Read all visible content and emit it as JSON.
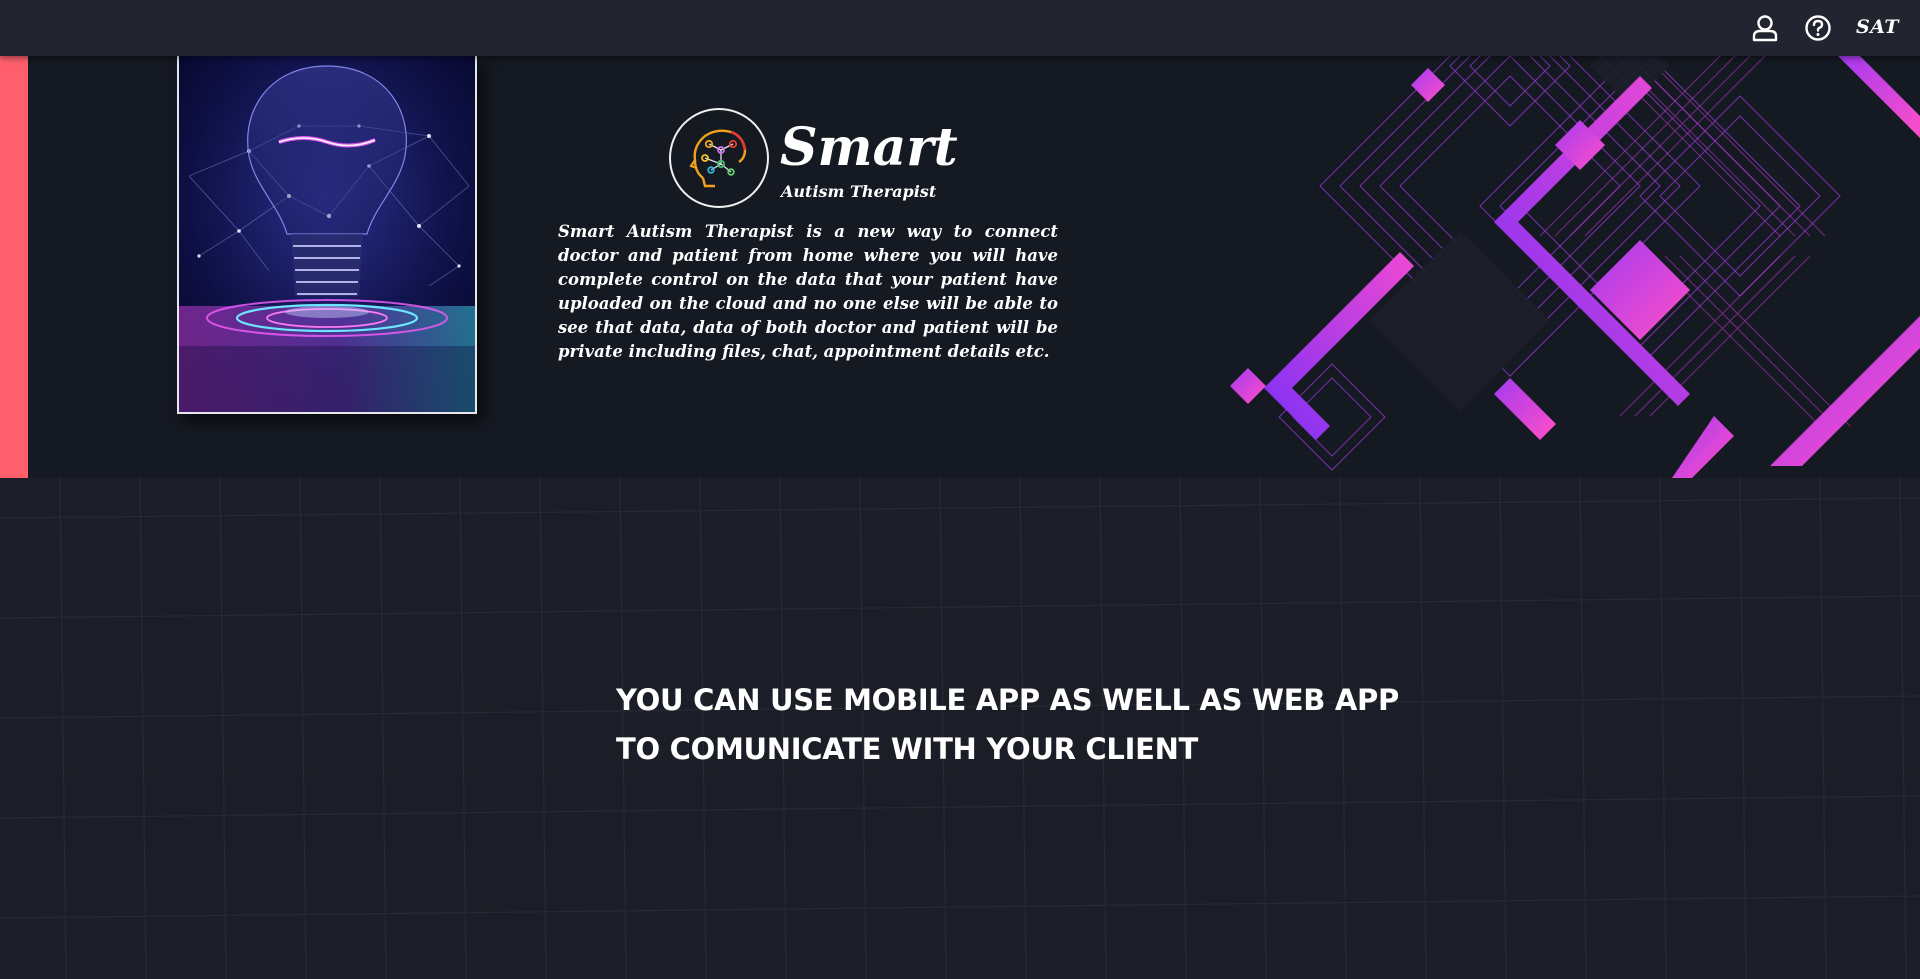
{
  "topbar": {
    "user_icon": "user-icon",
    "help_icon": "help-circle-icon",
    "brand_abbr": "SAT"
  },
  "hero": {
    "image": "glowing-lightbulb-illustration",
    "logo_icon": "brain-circuit-icon",
    "title": "Smart",
    "subtitle": "Autism Therapist",
    "description": "Smart Autism Therapist is a new way to connect doctor and patient from home where you will have complete control on the data that your patient have uploaded on the cloud and no one else will be able to see that data, data of both doctor and patient will be private including files, chat, appointment details etc.",
    "accent_color": "#ff5f6d"
  },
  "feature": {
    "line1": "YOU CAN USE MOBILE APP AS WELL AS WEB APP",
    "line2": "TO COMUNICATE WITH YOUR CLIENT"
  },
  "colors": {
    "topbar_bg": "#22242f",
    "hero_bg": "#151922",
    "page_bg": "#1b1e26",
    "magenta": "#e83bd6",
    "violet": "#7b2ff7"
  }
}
